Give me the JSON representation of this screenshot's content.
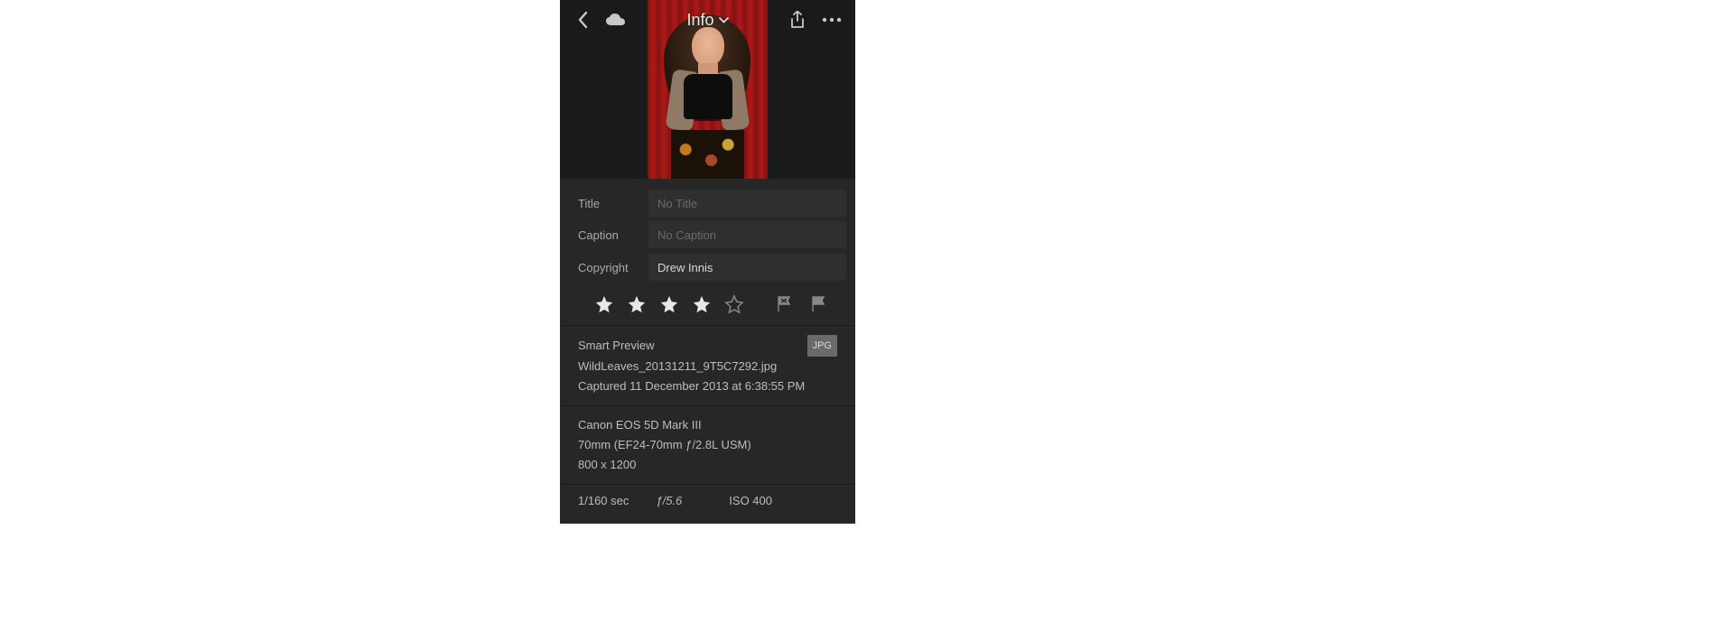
{
  "topbar": {
    "dropdown_label": "Info"
  },
  "fields": {
    "title_label": "Title",
    "title_placeholder": "No Title",
    "title_value": "",
    "caption_label": "Caption",
    "caption_placeholder": "No Caption",
    "caption_value": "",
    "copyright_label": "Copyright",
    "copyright_placeholder": "",
    "copyright_value": "Drew Innis"
  },
  "rating": {
    "stars_filled": 4,
    "stars_total": 5
  },
  "file": {
    "preview_type": "Smart Preview",
    "format_badge": "JPG",
    "filename": "WildLeaves_20131211_9T5C7292.jpg",
    "captured": "Captured 11 December 2013 at 6:38:55 PM"
  },
  "camera": {
    "model": "Canon EOS 5D Mark III",
    "lens": "70mm (EF24-70mm ƒ/2.8L USM)",
    "dimensions": "800 x 1200"
  },
  "exposure": {
    "shutter": "1/160 sec",
    "aperture": "ƒ/5.6",
    "iso": "ISO 400"
  }
}
